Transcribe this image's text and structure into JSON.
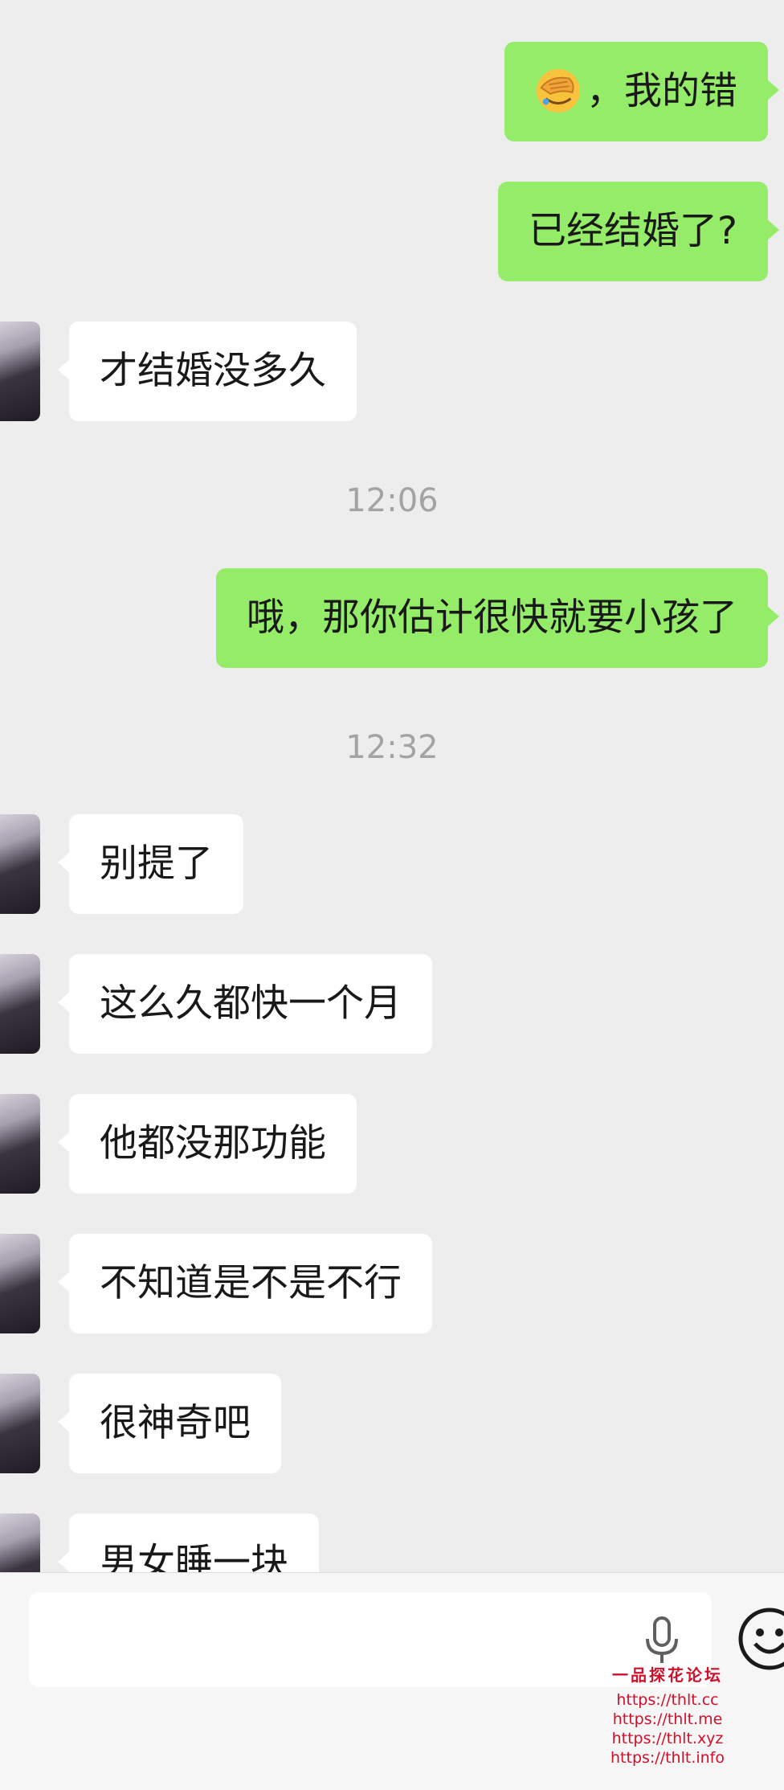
{
  "messages": [
    {
      "side": "out",
      "text": "，我的错",
      "emoji": "face-palm-emoji"
    },
    {
      "side": "out",
      "text": "已经结婚了?"
    },
    {
      "side": "in",
      "text": "才结婚没多久"
    },
    {
      "side": "time",
      "text": "12:06"
    },
    {
      "side": "out",
      "text": "哦，那你估计很快就要小孩了"
    },
    {
      "side": "time",
      "text": "12:32"
    },
    {
      "side": "in",
      "text": "别提了"
    },
    {
      "side": "in",
      "text": "这么久都快一个月"
    },
    {
      "side": "in",
      "text": "他都没那功能"
    },
    {
      "side": "in",
      "text": "不知道是不是不行"
    },
    {
      "side": "in",
      "text": "很神奇吧"
    },
    {
      "side": "in",
      "text": "男女睡一块"
    }
  ],
  "input_bar": {
    "placeholder": ""
  },
  "watermark": {
    "title": "一品探花论坛",
    "links": [
      "https://thlt.cc",
      "https://thlt.me",
      "https://thlt.xyz",
      "https://thlt.info"
    ]
  },
  "colors": {
    "outgoing_bubble": "#95ec69",
    "incoming_bubble": "#ffffff",
    "background": "#ededed",
    "watermark": "#d0102a"
  }
}
